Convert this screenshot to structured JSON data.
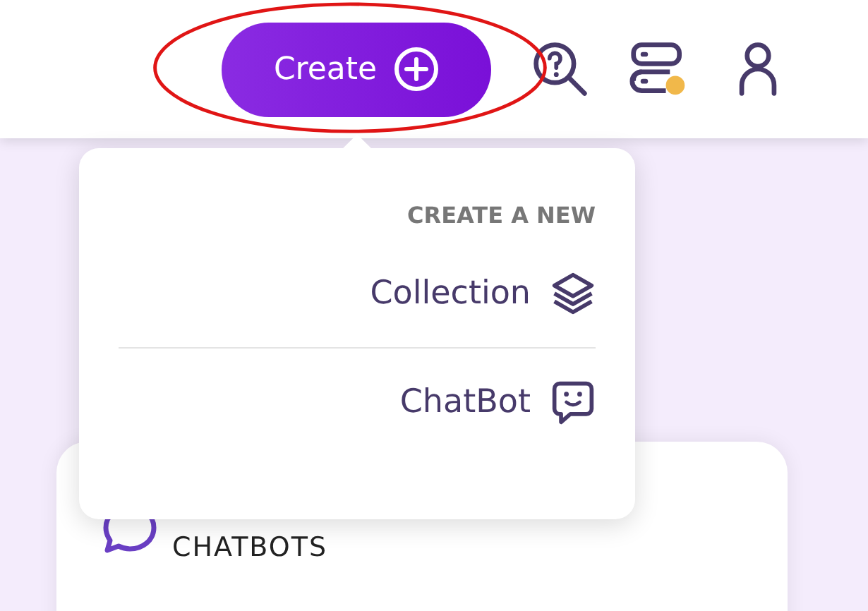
{
  "header": {
    "create_button": "Create"
  },
  "dropdown": {
    "heading": "CREATE A NEW",
    "items": [
      {
        "label": "Collection",
        "kind": "collection"
      },
      {
        "label": "ChatBot",
        "kind": "chatbot"
      }
    ]
  },
  "card": {
    "title": "CHATBOTS"
  }
}
